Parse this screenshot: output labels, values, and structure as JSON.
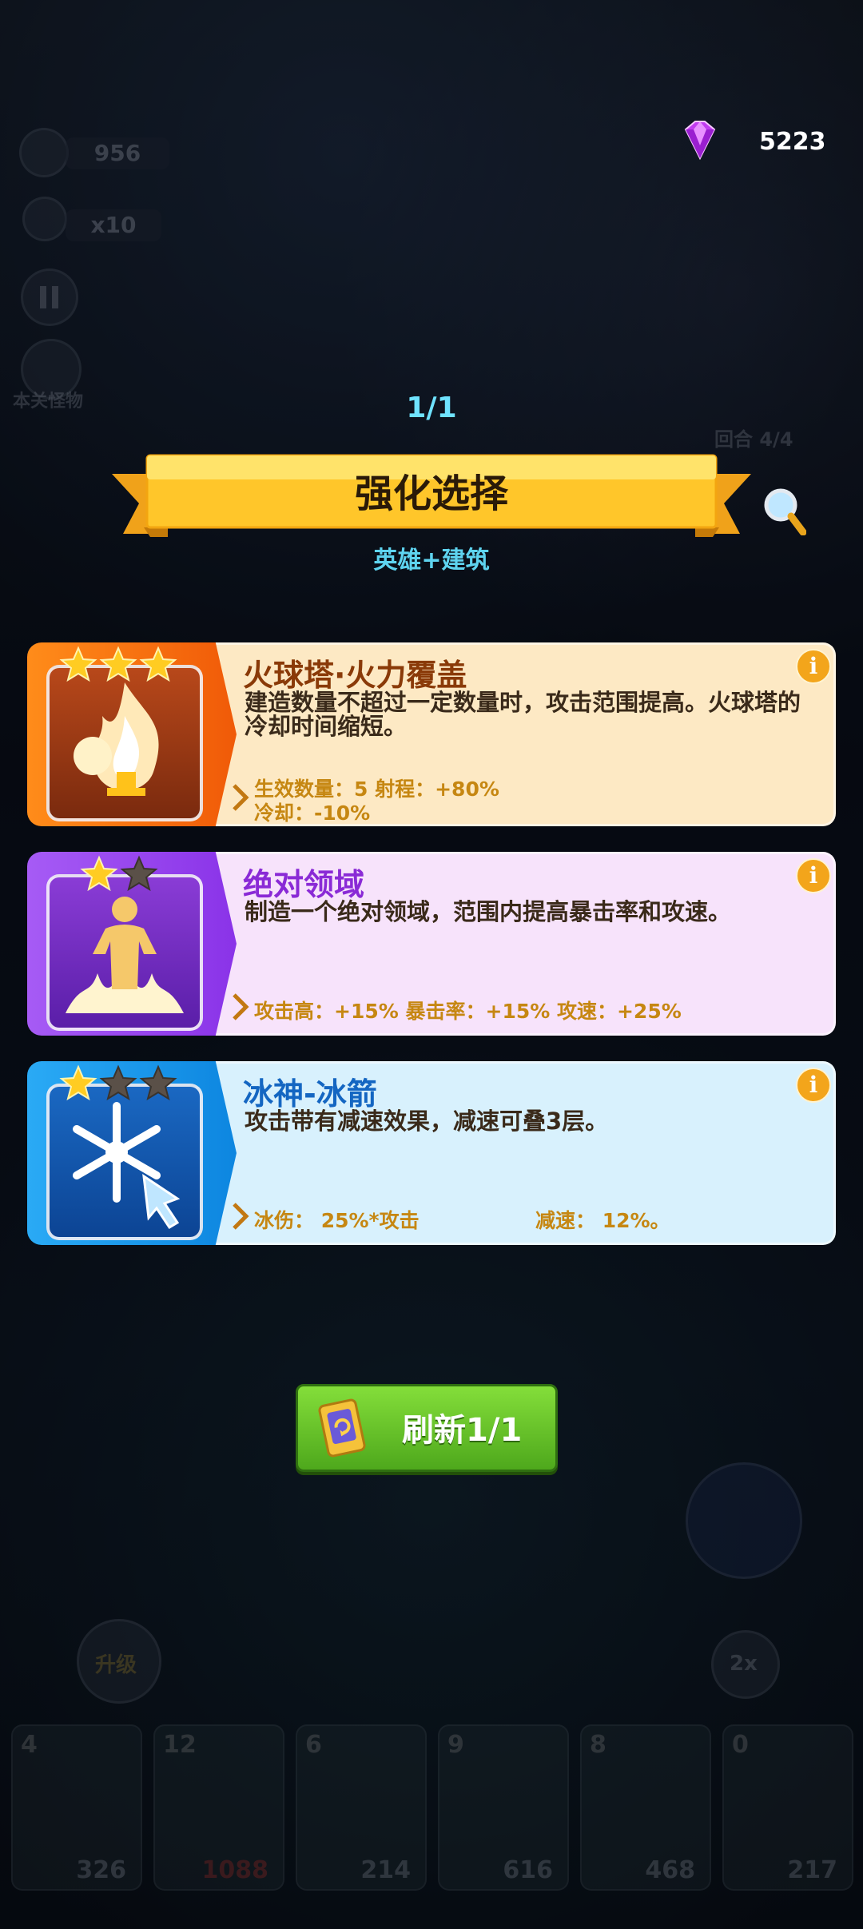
{
  "hud": {
    "resource_value": "956",
    "multiplier": "x10",
    "monster_label": "本关怪物",
    "round_label": "回合 4/4",
    "upgrade_label": "升级",
    "speed_label": "2x"
  },
  "currency": {
    "gems": "5223",
    "gem_icon": "purple-diamond"
  },
  "selection": {
    "counter": "1/1",
    "title": "强化选择",
    "subtitle": "英雄+建筑"
  },
  "cards": [
    {
      "name": "火球塔·火力覆盖",
      "description": "建造数量不超过一定数量时，攻击范围提高。火球塔的冷却时间缩短。",
      "stats_line1": "生效数量：5 射程：+80%",
      "stats_line2": "冷却：-10%",
      "stars_filled": 3,
      "stars_total": 3,
      "icon": "fireball-tower-icon",
      "theme": "#ff7a10"
    },
    {
      "name": "绝对领域",
      "description": "制造一个绝对领域，范围内提高暴击率和攻速。",
      "stats_line1": "攻击高：+15% 暴击率：+15% 攻速：+25%",
      "stars_filled": 1,
      "stars_total": 2,
      "icon": "absolute-domain-icon",
      "theme": "#9a4df0"
    },
    {
      "name": "冰神-冰箭",
      "description": "攻击带有减速效果，减速可叠3层。",
      "stats_line1": "冰伤： 25%*攻击",
      "stats_line1b": "减速： 12%。",
      "stars_filled": 1,
      "stars_total": 3,
      "icon": "ice-arrow-icon",
      "theme": "#1a9cf0"
    }
  ],
  "refresh_button": {
    "label": "刷新1/1"
  },
  "tower_bar": [
    {
      "level": "4",
      "cost": "326"
    },
    {
      "level": "12",
      "cost": "1088"
    },
    {
      "level": "6",
      "cost": "214"
    },
    {
      "level": "9",
      "cost": "616"
    },
    {
      "level": "8",
      "cost": "468"
    },
    {
      "level": "0",
      "cost": "217"
    }
  ]
}
